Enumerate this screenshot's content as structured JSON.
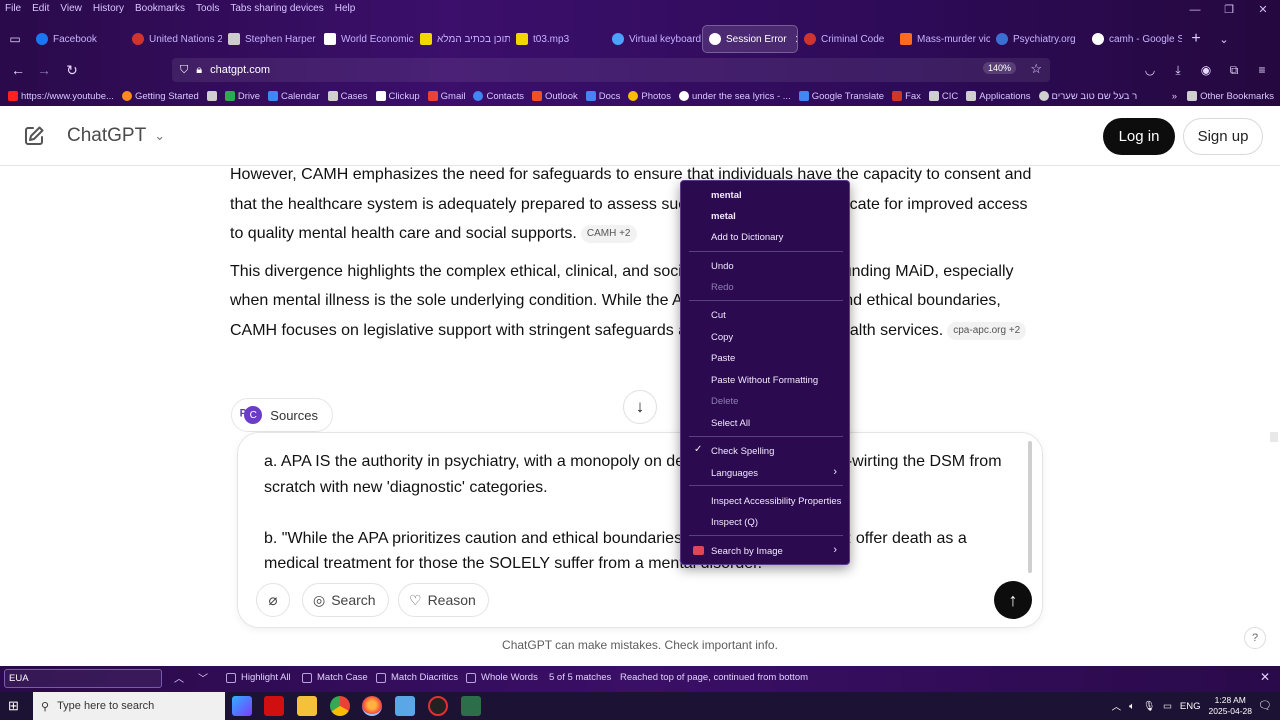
{
  "browser": {
    "menu": [
      "File",
      "Edit",
      "View",
      "History",
      "Bookmarks",
      "Tools",
      "Tabs sharing devices",
      "Help"
    ],
    "tabs": [
      {
        "label": "Facebook",
        "color": "#1877f2"
      },
      {
        "label": "United Nations 2",
        "color": "#d0342c"
      },
      {
        "label": "Stephen Harper",
        "color": "#cccccc"
      },
      {
        "label": "World Economic",
        "color": "#ffffff"
      },
      {
        "label": "תוכן בכתיב המלא",
        "color": "#f2d600"
      },
      {
        "label": "t03.mp3",
        "color": "#f2d600"
      },
      {
        "label": "Virtual keyboard",
        "color": "#4aa3ff"
      },
      {
        "label": "Session Error",
        "color": "#ffffff",
        "active": true
      },
      {
        "label": "Criminal Code",
        "color": "#d0342c"
      },
      {
        "label": "Mass-murder vic",
        "color": "#ff6a1f"
      },
      {
        "label": "Psychiatry.org",
        "color": "#3b6fd4"
      },
      {
        "label": "camh - Google S",
        "color": "#ffffff"
      }
    ],
    "url": "chatgpt.com",
    "zoom": "140%",
    "bookmarks": [
      {
        "label": "https://www.youtube...",
        "color": "#ff2020"
      },
      {
        "label": "Getting Started",
        "color": "#ff8a1f"
      },
      {
        "label": "",
        "color": "#cfcfcf"
      },
      {
        "label": "Drive",
        "color": "#2fa84f"
      },
      {
        "label": "Calendar",
        "color": "#4285f4"
      },
      {
        "label": "Cases",
        "color": "#cfcfcf"
      },
      {
        "label": "Clickup",
        "color": "#ffffff"
      },
      {
        "label": "Gmail",
        "color": "#ea4335"
      },
      {
        "label": "Contacts",
        "color": "#4285f4"
      },
      {
        "label": "Outlook",
        "color": "#f25022"
      },
      {
        "label": "Docs",
        "color": "#4285f4"
      },
      {
        "label": "Photos",
        "color": "#fbbc05"
      },
      {
        "label": "under the sea lyrics - ...",
        "color": "#ffffff"
      },
      {
        "label": "Google Translate",
        "color": "#4285f4"
      },
      {
        "label": "Fax",
        "color": "#d0342c"
      },
      {
        "label": "CIC",
        "color": "#cfcfcf"
      },
      {
        "label": "Applications",
        "color": "#cfcfcf"
      },
      {
        "label": "ר בעל שם טוב שערים",
        "color": "#cfcfcf"
      }
    ],
    "other_bookmarks": "Other Bookmarks"
  },
  "header": {
    "brand": "ChatGPT",
    "login": "Log in",
    "signup": "Sign up"
  },
  "content": {
    "para1": "However, CAMH emphasizes the need for safeguards to ensure that individuals have the capacity to consent and that the healthcare system is adequately prepared to assess such decisions. They advocate for improved access to quality mental health care and social supports.",
    "para1_cite": "CAMH +2",
    "para2": "This divergence highlights the complex ethical, clinical, and social considerations surrounding MAiD, especially when mental illness is the sole underlying condition. While the APA prioritizes caution and ethical boundaries, CAMH focuses on legislative support with stringent safeguards and improved mental health services.",
    "para2_cite": "cpa-apc.org +2",
    "sources": "Sources"
  },
  "composer": {
    "line_a": "a. APA IS the authority in psychiatry, with a monopoly on defining mental illness, re-wirting the DSM from scratch with new 'diagnostic' categories.",
    "line_b": "b. \"While the APA prioritizes caution and ethical boundaries...\" - they would NEVER offer death as a medical treatment for those the SOLELY suffer from a mental disorder.",
    "search": "Search",
    "reason": "Reason"
  },
  "disclaimer": "ChatGPT can make mistakes. Check important info.",
  "context_menu": {
    "suggestion1": "mental",
    "suggestion2": "metal",
    "add_dictionary": "Add to Dictionary",
    "undo": "Undo",
    "redo": "Redo",
    "cut": "Cut",
    "copy": "Copy",
    "paste": "Paste",
    "paste_plain": "Paste Without Formatting",
    "delete": "Delete",
    "select_all": "Select All",
    "check_spelling": "Check Spelling",
    "languages": "Languages",
    "inspect_accessibility": "Inspect Accessibility Properties",
    "inspect": "Inspect (Q)",
    "search_image": "Search by Image"
  },
  "findbar": {
    "query": "EUA",
    "highlight_all": "Highlight All",
    "match_case": "Match Case",
    "match_diacritics": "Match Diacritics",
    "whole_words": "Whole Words",
    "count": "5 of 5 matches",
    "status": "Reached top of page, continued from bottom"
  },
  "taskbar": {
    "search_placeholder": "Type here to search",
    "lang": "ENG",
    "time": "1:28 AM",
    "date": "2025-04-28"
  }
}
